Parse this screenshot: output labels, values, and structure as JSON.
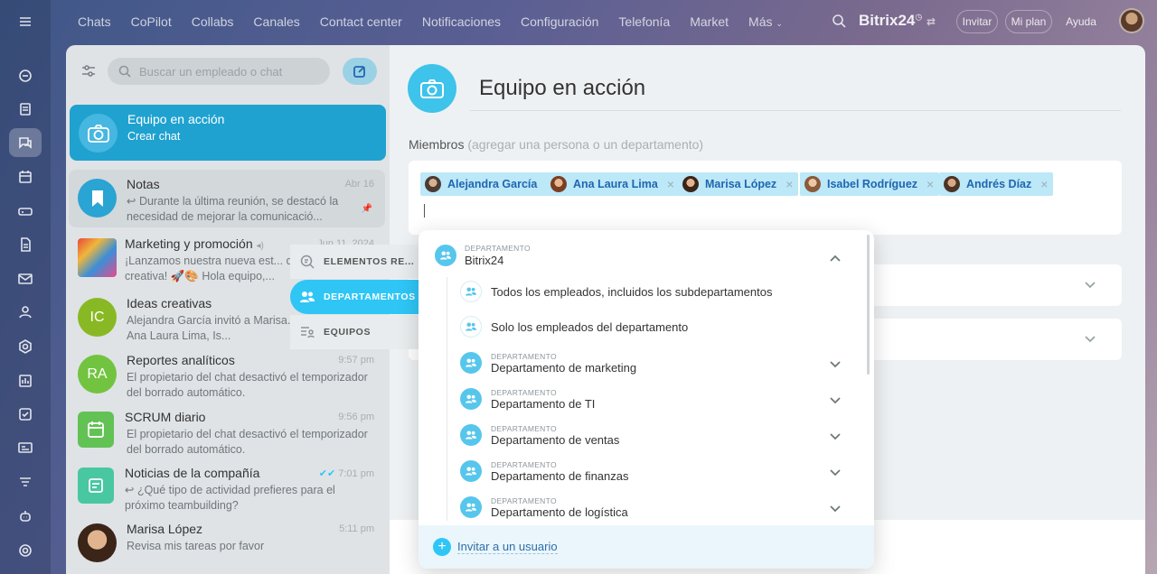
{
  "topnav": {
    "items": [
      "Chats",
      "CoPilot",
      "Collabs",
      "Canales",
      "Contact center",
      "Notificaciones",
      "Configuración",
      "Telefonía",
      "Market",
      "Más"
    ],
    "brand": "Bitrix",
    "brand_suffix": "24",
    "invite": "Invitar",
    "my_plan": "Mi plan",
    "help": "Ayuda"
  },
  "chatlist": {
    "search_placeholder": "Buscar un empleado o chat",
    "items": [
      {
        "name": "Equipo en acción",
        "preview": "Crear chat",
        "time": "",
        "initials": ""
      },
      {
        "name": "Notas",
        "preview": "↩ Durante la última reunión, se destacó la necesidad de mejorar la comunicació...",
        "time": "Abr 16",
        "initials": ""
      },
      {
        "name": "Marketing y promoción",
        "preview": "¡Lanzamos nuestra nueva est... de marketing creativa! 🚀🎨 Hola equipo,...",
        "time": "Jun 11, 2024",
        "initials": ""
      },
      {
        "name": "Ideas creativas",
        "preview": "Alejandra García invitó a Marisa... Andrés Díaz, Ana Laura Lima, Is...",
        "time": "",
        "initials": "IC"
      },
      {
        "name": "Reportes analíticos",
        "preview": "El propietario del chat desactivó el temporizador del borrado automático.",
        "time": "9:57 pm",
        "initials": "RA"
      },
      {
        "name": "SCRUM diario",
        "preview": "El propietario del chat desactivó el temporizador del borrado automático.",
        "time": "9:56 pm",
        "initials": ""
      },
      {
        "name": "Noticias de la compañía",
        "preview": "↩ ¿Qué tipo de actividad prefieres para el próximo teambuilding?",
        "time": "7:01 pm",
        "initials": ""
      },
      {
        "name": "Marisa López",
        "preview": "Revisa mis tareas por favor",
        "time": "5:11 pm",
        "initials": ""
      }
    ]
  },
  "main": {
    "title": "Equipo en acción",
    "members_label": "Miembros",
    "members_hint": "(agregar una persona o un departamento)",
    "chips": [
      "Alejandra García",
      "Ana Laura Lima",
      "Marisa López",
      "Isabel Rodríguez",
      "Andrés Díaz"
    ],
    "chip_close": "×"
  },
  "tabs": [
    "ELEMENTOS RE...",
    "DEPARTAMENTOS",
    "EQUIPOS"
  ],
  "dropdown": {
    "dept_label": "DEPARTAMENTO",
    "root_name": "Bitrix24",
    "option_all": "Todos los empleados, incluidos los subdepartamentos",
    "option_only": "Solo los empleados del departamento",
    "departments": [
      "Departamento de marketing",
      "Departamento de TI",
      "Departamento de ventas",
      "Departamento de finanzas",
      "Departamento de logística"
    ],
    "invite_user": "Invitar a un usuario"
  },
  "colors": {
    "accent": "#2fc6f6",
    "selected_chat": "#1fa2cf",
    "chip_bg": "#bce8f8",
    "chip_text": "#2066b0"
  }
}
